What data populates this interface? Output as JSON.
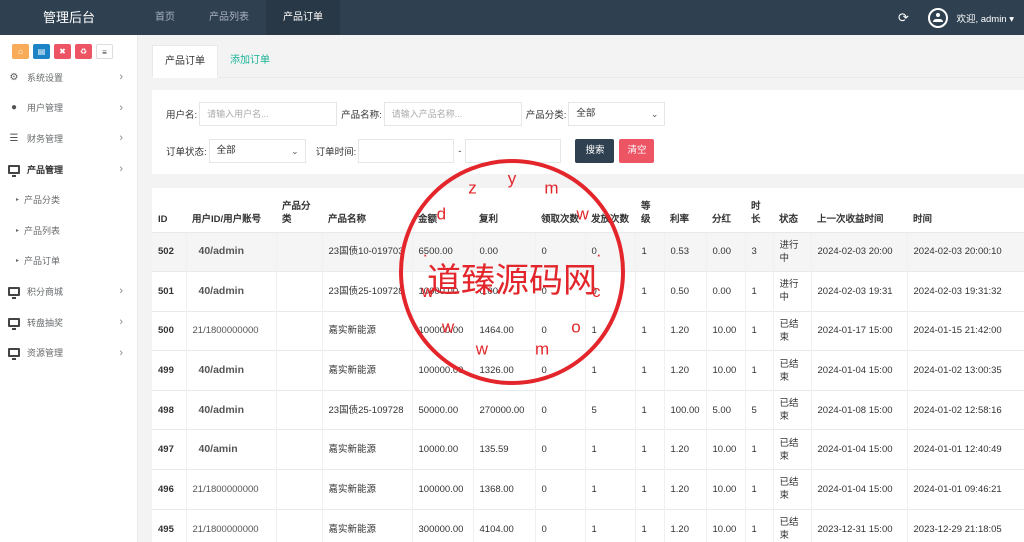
{
  "header": {
    "brand": "管理后台",
    "nav": [
      "首页",
      "产品列表",
      "产品订单"
    ],
    "active_nav_index": 2,
    "welcome": "欢迎, admin ▾",
    "bg_color": "#2f4050"
  },
  "sidebar": {
    "quick_buttons": [
      "home-icon",
      "file-icon",
      "trash-icon",
      "recycle-icon",
      "list-icon"
    ],
    "items": [
      {
        "label": "系统设置",
        "icon": "gear-icon"
      },
      {
        "label": "用户管理",
        "icon": "user-icon"
      },
      {
        "label": "财务管理",
        "icon": "database-icon"
      },
      {
        "label": "产品管理",
        "icon": "monitor-icon",
        "active": true
      },
      {
        "label": "产品分类",
        "sub": true
      },
      {
        "label": "产品列表",
        "sub": true
      },
      {
        "label": "产品订单",
        "sub": true
      },
      {
        "label": "积分商城",
        "icon": "monitor-icon"
      },
      {
        "label": "转盘抽奖",
        "icon": "monitor-icon"
      },
      {
        "label": "资源管理",
        "icon": "monitor-icon"
      }
    ]
  },
  "tabs": [
    "产品订单",
    "添加订单"
  ],
  "search": {
    "username_label": "用户名:",
    "username_placeholder": "请输入用户名...",
    "product_label": "产品名称:",
    "product_placeholder": "请输入产品名称...",
    "category_label": "产品分类:",
    "category_value": "全部",
    "status_label": "订单状态:",
    "status_value": "全部",
    "time_label": "订单时间:",
    "time_separator": "-",
    "search_button": "搜索",
    "clear_button": "清空"
  },
  "table": {
    "columns": [
      "ID",
      "用户ID/用户账号",
      "产品分类",
      "产品名称",
      "金额",
      "复利",
      "领取次数",
      "发放次数",
      "等级",
      "利率",
      "分红",
      "时长",
      "状态",
      "上一次收益时间",
      "时间"
    ],
    "rows": [
      [
        "502",
        "40/admin",
        "",
        "23国债10-019703",
        "6500.00",
        "0.00",
        "0",
        "0",
        "1",
        "0.53",
        "0.00",
        "3",
        "进行中",
        "2024-02-03 20:00",
        "2024-02-03 20:00:10"
      ],
      [
        "501",
        "40/admin",
        "",
        "23国债25-109728",
        "10000.00",
        "0.00",
        "0",
        "0",
        "1",
        "0.50",
        "0.00",
        "1",
        "进行中",
        "2024-02-03 19:31",
        "2024-02-03 19:31:32"
      ],
      [
        "500",
        "21/1800000000",
        "",
        "嘉实新能源",
        "100000.00",
        "1464.00",
        "0",
        "1",
        "1",
        "1.20",
        "10.00",
        "1",
        "已结束",
        "2024-01-17 15:00",
        "2024-01-15 21:42:00"
      ],
      [
        "499",
        "40/admin",
        "",
        "嘉实新能源",
        "100000.00",
        "1326.00",
        "0",
        "1",
        "1",
        "1.20",
        "10.00",
        "1",
        "已结束",
        "2024-01-04 15:00",
        "2024-01-02 13:00:35"
      ],
      [
        "498",
        "40/admin",
        "",
        "23国债25-109728",
        "50000.00",
        "270000.00",
        "0",
        "5",
        "1",
        "100.00",
        "5.00",
        "5",
        "已结束",
        "2024-01-08 15:00",
        "2024-01-02 12:58:16"
      ],
      [
        "497",
        "40/amin",
        "",
        "嘉实新能源",
        "10000.00",
        "135.59",
        "0",
        "1",
        "1",
        "1.20",
        "10.00",
        "1",
        "已结束",
        "2024-01-04 15:00",
        "2024-01-01 12:40:49"
      ],
      [
        "496",
        "21/1800000000",
        "",
        "嘉实新能源",
        "100000.00",
        "1368.00",
        "0",
        "1",
        "1",
        "1.20",
        "10.00",
        "1",
        "已结束",
        "2024-01-04 15:00",
        "2024-01-01 09:46:21"
      ],
      [
        "495",
        "21/1800000000",
        "",
        "嘉实新能源",
        "300000.00",
        "4104.00",
        "0",
        "1",
        "1",
        "1.20",
        "10.00",
        "1",
        "已结束",
        "2023-12-31 15:00",
        "2023-12-29 21:18:05"
      ]
    ]
  },
  "watermark": {
    "center_text": "道臻源码网",
    "ring_text": "w w w . d z y m w . c o m",
    "color": "#e3262b"
  }
}
